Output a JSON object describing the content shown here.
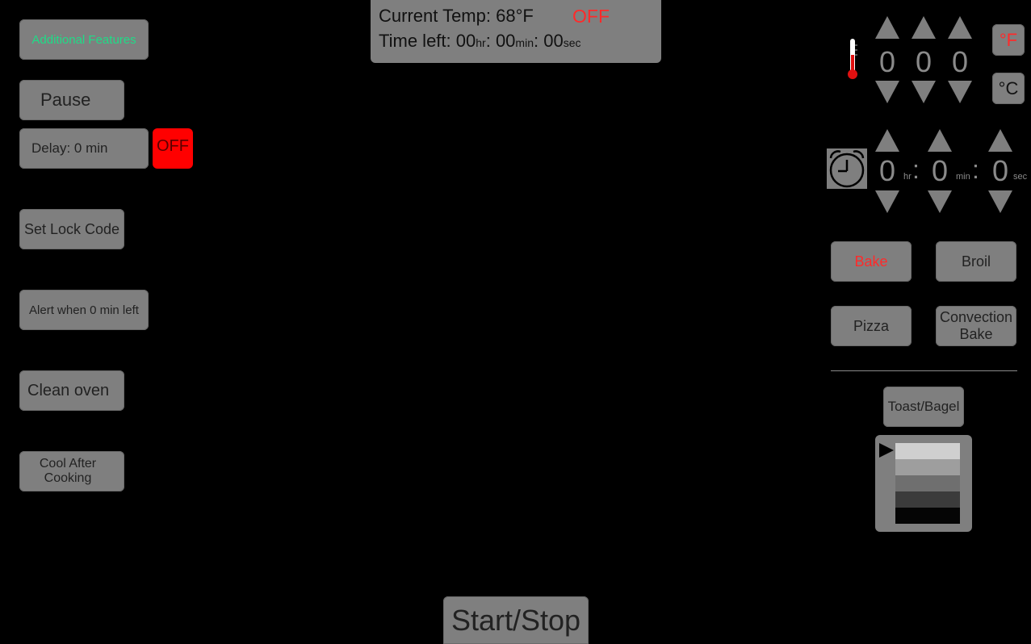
{
  "colors": {
    "accent_green": "#1fdc87",
    "alert_red": "#ff2a2a",
    "button_gray": "#7f7f7f"
  },
  "status": {
    "current_temp_label": "Current Temp: 68°F",
    "power_state": "OFF",
    "time_left_prefix": "Time left: ",
    "hr_value": "00",
    "hr_unit": "hr",
    "min_value": "00",
    "min_unit": "min",
    "sec_value": "00",
    "sec_unit": "sec",
    "sep": ": "
  },
  "left_panel": {
    "additional_features": "Additional Features",
    "pause": "Pause",
    "delay": "Delay: 0 min",
    "delay_toggle": "OFF",
    "set_lock_code": "Set Lock Code",
    "alert": "Alert when 0 min left",
    "clean_oven": "Clean oven",
    "cool_after_cooking_line1": "Cool After",
    "cool_after_cooking_line2": "Cooking"
  },
  "temp_setter": {
    "digits": [
      "0",
      "0",
      "0"
    ],
    "unit_f": "°F",
    "unit_c": "°C",
    "icon": "thermometer-icon"
  },
  "timer_setter": {
    "hours": "0",
    "hr_label": "hr",
    "minutes": "0",
    "min_label": "min",
    "seconds": "0",
    "sec_label": "sec",
    "colon": ":",
    "icon": "alarm-clock-icon"
  },
  "modes": {
    "bake": "Bake",
    "broil": "Broil",
    "pizza": "Pizza",
    "convection_line1": "Convection",
    "convection_line2": "Bake",
    "toast_bagel": "Toast/Bagel"
  },
  "toast_shades": {
    "selected_level": 1,
    "shade_colors": [
      "#cfcfcf",
      "#9e9e9e",
      "#6f6f6f",
      "#3b3b3b",
      "#050505"
    ]
  },
  "start_stop": "Start/Stop"
}
